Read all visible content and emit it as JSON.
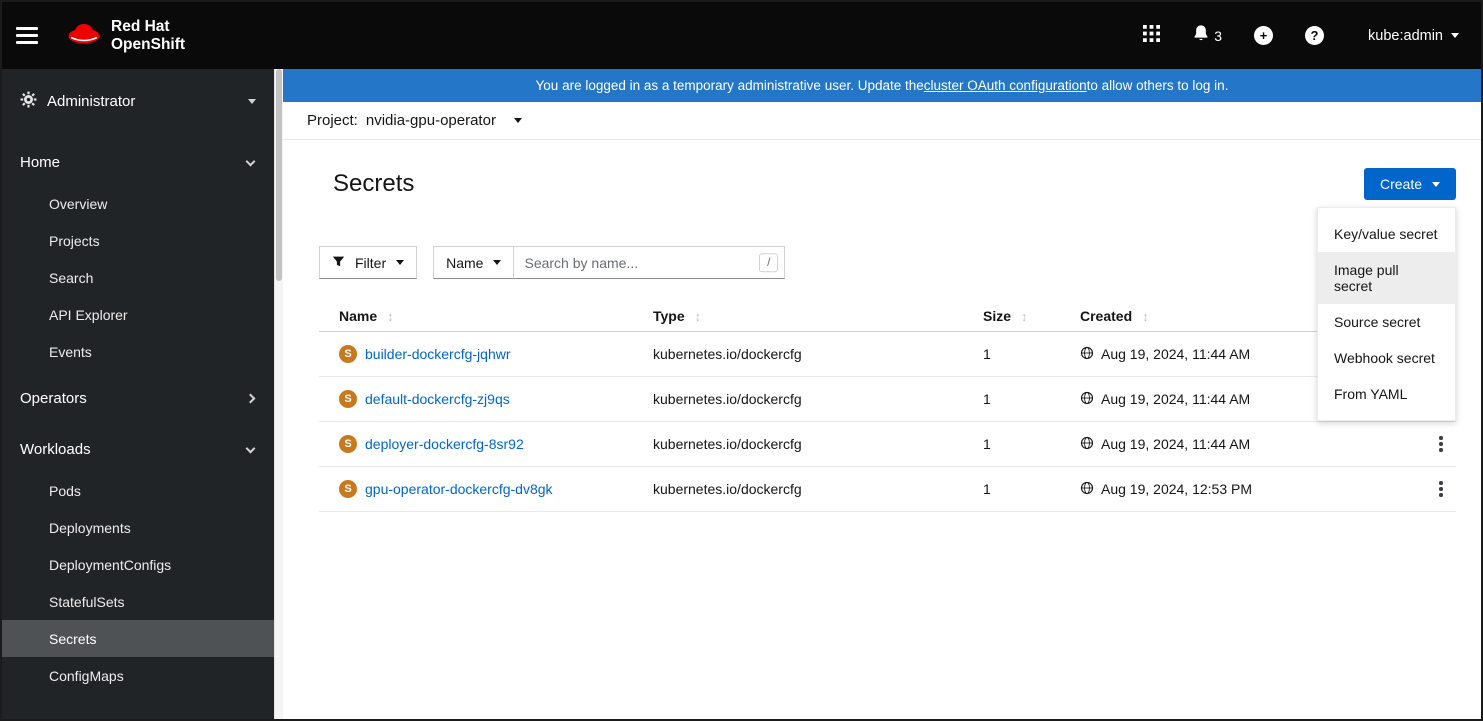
{
  "masthead": {
    "brand_line1": "Red Hat",
    "brand_line2": "OpenShift",
    "notification_count": "3",
    "username": "kube:admin"
  },
  "banner": {
    "text_before": "You are logged in as a temporary administrative user. Update the ",
    "link_text": "cluster OAuth configuration",
    "text_after": " to allow others to log in."
  },
  "project_bar": {
    "label": "Project:",
    "value": "nvidia-gpu-operator"
  },
  "page": {
    "title": "Secrets",
    "create_label": "Create"
  },
  "create_menu": {
    "items": [
      {
        "label": "Key/value secret",
        "active": false
      },
      {
        "label": "Image pull secret",
        "active": true
      },
      {
        "label": "Source secret",
        "active": false
      },
      {
        "label": "Webhook secret",
        "active": false
      },
      {
        "label": "From YAML",
        "active": false
      }
    ]
  },
  "toolbar": {
    "filter_label": "Filter",
    "name_label": "Name",
    "search_placeholder": "Search by name...",
    "search_shortcut": "/"
  },
  "table": {
    "columns": [
      "Name",
      "Type",
      "Size",
      "Created"
    ],
    "badge": "S",
    "rows": [
      {
        "name": "builder-dockercfg-jqhwr",
        "type": "kubernetes.io/dockercfg",
        "size": "1",
        "created": "Aug 19, 2024, 11:44 AM"
      },
      {
        "name": "default-dockercfg-zj9qs",
        "type": "kubernetes.io/dockercfg",
        "size": "1",
        "created": "Aug 19, 2024, 11:44 AM"
      },
      {
        "name": "deployer-dockercfg-8sr92",
        "type": "kubernetes.io/dockercfg",
        "size": "1",
        "created": "Aug 19, 2024, 11:44 AM"
      },
      {
        "name": "gpu-operator-dockercfg-dv8gk",
        "type": "kubernetes.io/dockercfg",
        "size": "1",
        "created": "Aug 19, 2024, 12:53 PM"
      }
    ]
  },
  "sidebar": {
    "perspective": "Administrator",
    "sections": [
      {
        "label": "Home",
        "expanded": true,
        "items": [
          "Overview",
          "Projects",
          "Search",
          "API Explorer",
          "Events"
        ]
      },
      {
        "label": "Operators",
        "expanded": false,
        "items": []
      },
      {
        "label": "Workloads",
        "expanded": true,
        "active_item": "Secrets",
        "items": [
          "Pods",
          "Deployments",
          "DeploymentConfigs",
          "StatefulSets",
          "Secrets",
          "ConfigMaps"
        ]
      }
    ]
  },
  "icons": {
    "sort": "↕"
  },
  "colors": {
    "banner_blue": "#2376c8",
    "primary_blue": "#0066cc",
    "link_blue": "#0066cc",
    "secret_orange": "#c8791d",
    "masthead_bg": "#0a0a0a",
    "sidebar_bg": "#212427",
    "sidebar_active": "#4f5255"
  }
}
